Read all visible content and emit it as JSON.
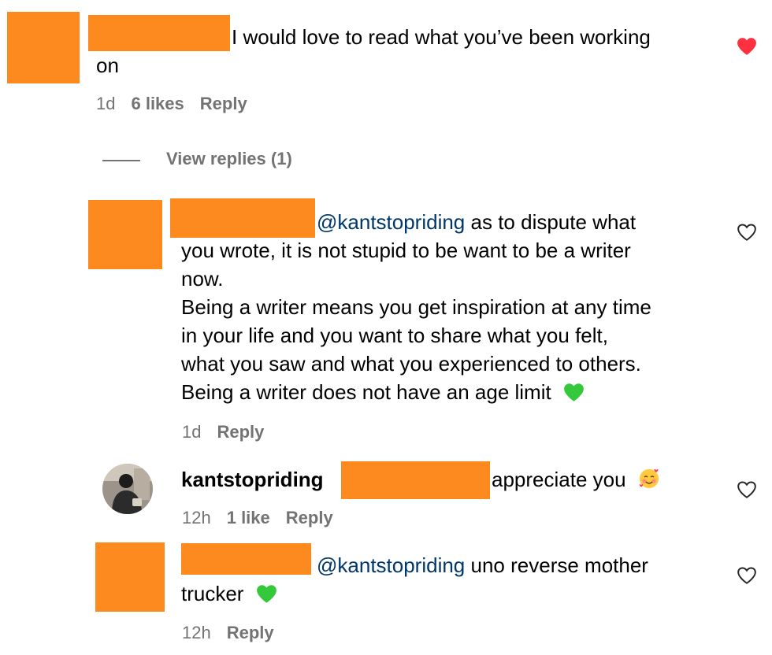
{
  "comment1": {
    "text_line1": "I would love to read what you’ve been working",
    "text_line2": "on",
    "time": "1d",
    "likes": "6 likes",
    "reply": "Reply",
    "liked": true
  },
  "view_replies": "View replies (1)",
  "reply1": {
    "mention": "@kantstopriding",
    "line1_rest": "as to dispute what",
    "line2": "you wrote, it is not stupid to be want to be a writer",
    "line3": "now.",
    "line4": "Being a writer means you get inspiration at any time",
    "line5": "in your life and you want to share what you felt,",
    "line6": "what you saw and what you experienced to others.",
    "line7": "Being a writer does not have an age limit",
    "emoji": "green-heart",
    "time": "1d",
    "reply": "Reply"
  },
  "reply2": {
    "username": "kantstopriding",
    "text": "appreciate you",
    "emoji": "smiling-face-with-hearts",
    "time": "12h",
    "likes": "1 like",
    "reply": "Reply"
  },
  "reply3": {
    "mention": "@kantstopriding",
    "line1_rest": "uno reverse mother",
    "line2": "trucker",
    "emoji": "green-heart",
    "time": "12h",
    "reply": "Reply"
  },
  "colors": {
    "redaction": "#fd8a1e",
    "mention": "#00376b",
    "liked_heart": "#ff3040",
    "meta_text": "#737373"
  }
}
